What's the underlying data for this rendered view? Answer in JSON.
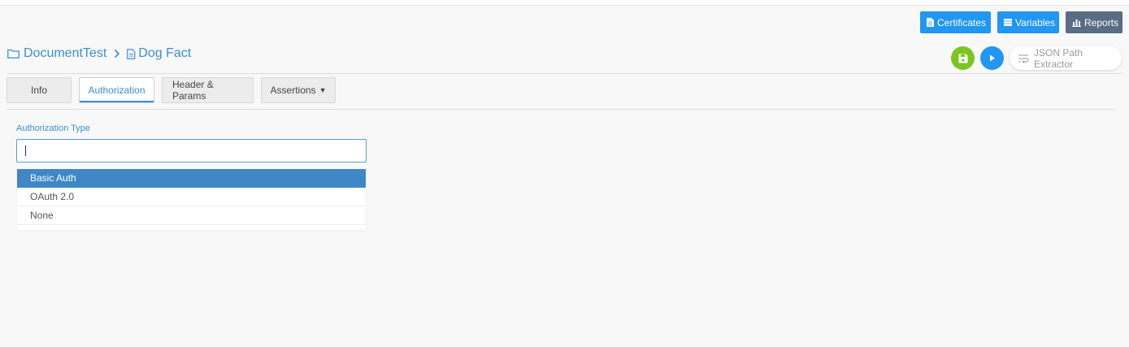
{
  "toolbar": {
    "certificates_label": "Certificates",
    "variables_label": "Variables",
    "reports_label": "Reports"
  },
  "breadcrumb": {
    "folder": "DocumentTest",
    "document": "Dog Fact"
  },
  "tools": {
    "json_path_label": "JSON Path Extractor"
  },
  "tabs": [
    {
      "label": "Info"
    },
    {
      "label": "Authorization"
    },
    {
      "label": "Header & Params"
    },
    {
      "label": "Assertions"
    }
  ],
  "auth": {
    "label": "Authorization Type",
    "value": "",
    "options": [
      "Basic Auth",
      "OAuth 2.0",
      "None"
    ],
    "highlighted": "Basic Auth"
  },
  "colors": {
    "accent": "#2196f3",
    "link": "#3a8fd6",
    "save": "#7cc520",
    "reports": "#5a6c84",
    "selected_option": "#3f87c7"
  }
}
